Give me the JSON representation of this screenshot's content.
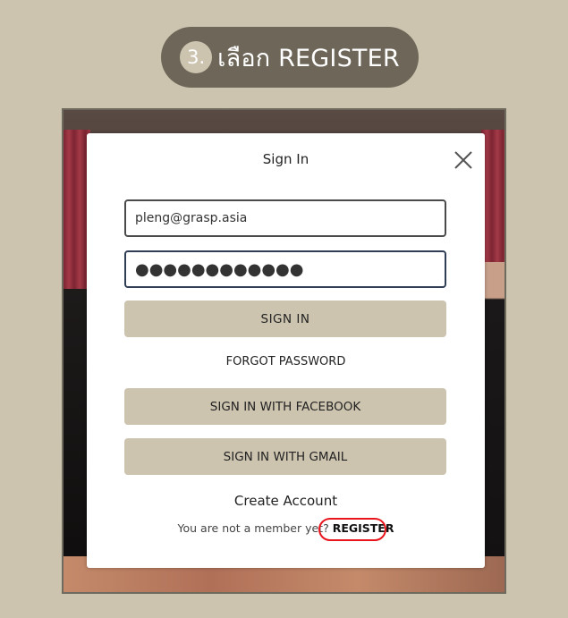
{
  "step": {
    "number": "3.",
    "text": "เลือก REGISTER",
    "pill_color": "#6e6759"
  },
  "modal": {
    "title": "Sign In",
    "close_icon": "close-icon",
    "email_value": "pleng@grasp.asia",
    "password_value": "●●●●●●●●●●●●",
    "sign_in_label": "SIGN IN",
    "forgot_label": "FORGOT PASSWORD",
    "facebook_label": "SIGN IN WITH FACEBOOK",
    "gmail_label": "SIGN IN WITH GMAIL",
    "create_account_label": "Create Account",
    "member_prompt": "You are not a member yet? ",
    "register_label": "REGISTER",
    "button_color": "#cdc4b0",
    "highlight_color": "#e8161c"
  }
}
